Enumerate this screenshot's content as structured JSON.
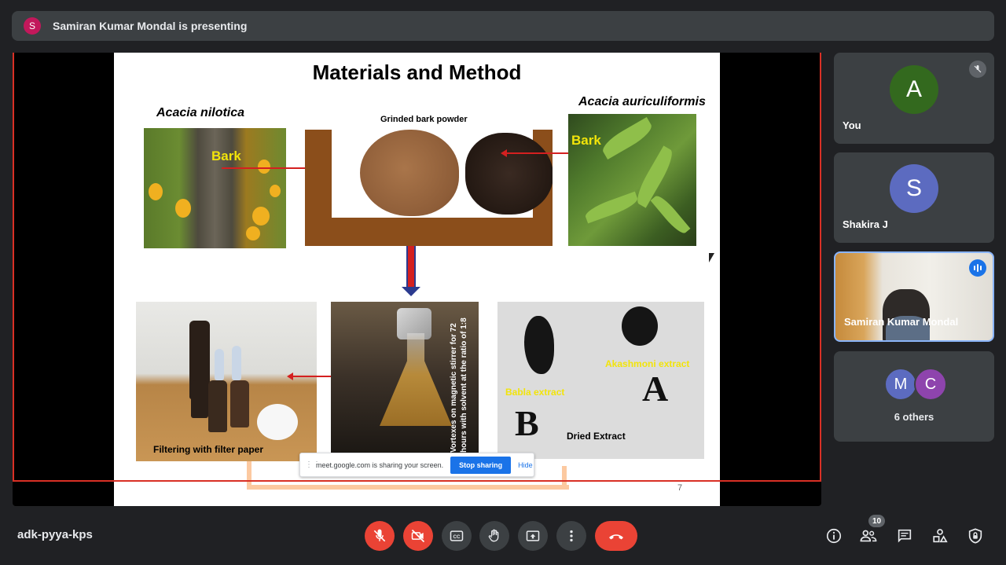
{
  "presenting_banner": {
    "avatar_letter": "S",
    "text": "Samiran Kumar Mondal is presenting"
  },
  "slide": {
    "title": "Materials and Method",
    "label_left": "Acacia nilotica",
    "label_right": "Acacia auriculiformis",
    "caption_powder": "Grinded bark powder",
    "bark_left": "Bark",
    "bark_right": "Bark",
    "stirrer_text": "Vortexes on magnetic stirrer for 72 hours with solvent at the ratio of 1:8",
    "filter_caption": "Filtering with filter paper",
    "babla_label": "Babla extract",
    "akashmoni_label": "Akashmoni extract",
    "letter_b": "B",
    "letter_a": "A",
    "dried_caption": "Dried Extract",
    "page_number": "7"
  },
  "share_bar": {
    "message": "meet.google.com is sharing your screen.",
    "stop_label": "Stop sharing",
    "hide_label": "Hide"
  },
  "participants": [
    {
      "name": "You",
      "avatar": "A",
      "color": "#33691e",
      "muted": true
    },
    {
      "name": "Shakira J",
      "avatar": "S",
      "color": "#5c6bc0"
    },
    {
      "name": "Samiran Kumar Mondal",
      "speaking": true
    },
    {
      "others_label": "6 others",
      "avatars": [
        "M",
        "C"
      ],
      "colors": [
        "#5c6bc0",
        "#8e44ad"
      ]
    }
  ],
  "meeting_code": "adk-pyya-kps",
  "people_count": "10",
  "controls": [
    "mic-off",
    "camera-off",
    "captions",
    "raise-hand",
    "present",
    "more-options",
    "leave-call"
  ],
  "right_controls": [
    "meeting-details",
    "people",
    "chat",
    "activities",
    "host-controls"
  ],
  "colors": {
    "accent_red": "#ea4335",
    "accent_blue": "#1a73e8",
    "surface": "#3c4043",
    "background": "#202124"
  }
}
